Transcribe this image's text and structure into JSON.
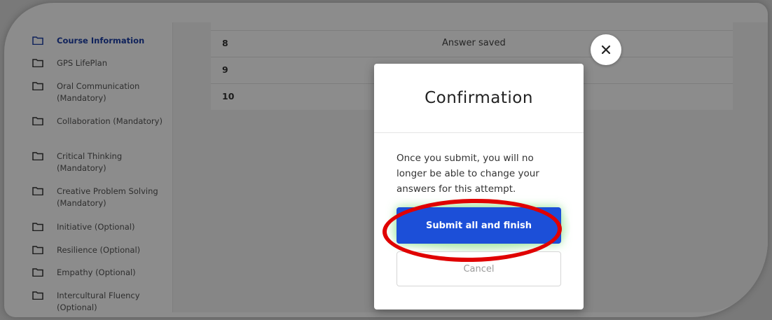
{
  "sidebar": {
    "items": [
      {
        "label": "Course Information",
        "active": true
      },
      {
        "label": "GPS LifePlan"
      },
      {
        "label": "Oral Communication (Mandatory)"
      },
      {
        "label": "Collaboration (Mandatory)"
      },
      {
        "label": "Critical Thinking (Mandatory)"
      },
      {
        "label": "Creative Problem Solving (Mandatory)"
      },
      {
        "label": "Initiative (Optional)"
      },
      {
        "label": "Resilience (Optional)"
      },
      {
        "label": "Empathy (Optional)"
      },
      {
        "label": "Intercultural Fluency (Optional)"
      }
    ]
  },
  "table": {
    "rows": [
      {
        "num": "8",
        "status": "Answer saved"
      },
      {
        "num": "9",
        "status": ""
      },
      {
        "num": "10",
        "status": ""
      }
    ]
  },
  "modal": {
    "title": "Confirmation",
    "body": "Once you submit, you will no longer be able to change your answers for this attempt.",
    "submit_label": "Submit all and finish",
    "cancel_label": "Cancel",
    "close_icon": "close-icon"
  },
  "colors": {
    "accent": "#1c4fd8",
    "active_link": "#1d3fa6",
    "highlight_ring": "#e00000"
  }
}
